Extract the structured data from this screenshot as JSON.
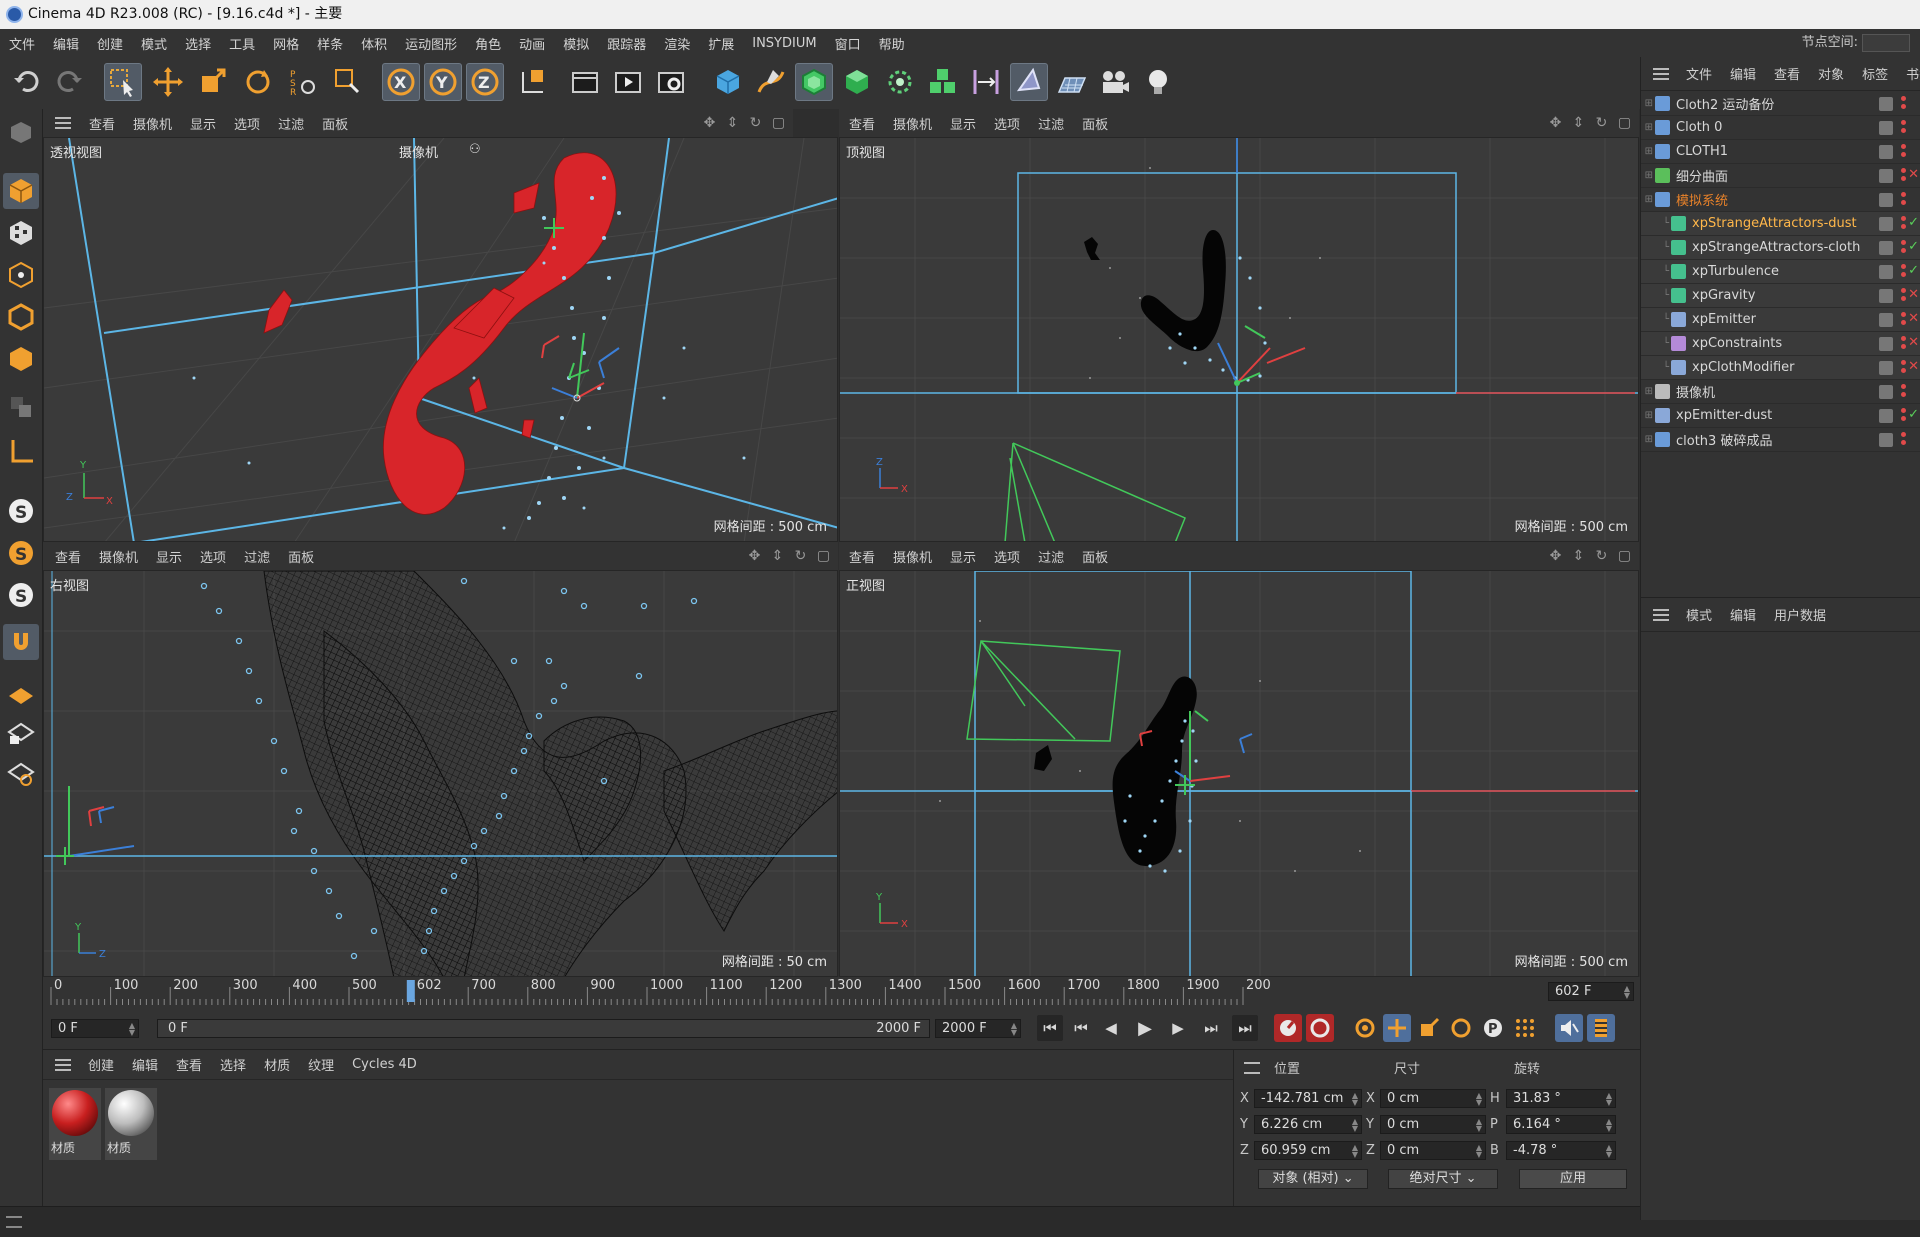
{
  "window": {
    "title": "Cinema 4D R23.008 (RC) - [9.16.c4d *] - 主要"
  },
  "menubar": {
    "items": [
      "文件",
      "编辑",
      "创建",
      "模式",
      "选择",
      "工具",
      "网格",
      "样条",
      "体积",
      "运动图形",
      "角色",
      "动画",
      "模拟",
      "跟踪器",
      "渲染",
      "扩展",
      "INSYDIUM",
      "窗口",
      "帮助"
    ],
    "node_space_label": "节点空间:"
  },
  "viewports": {
    "menu": [
      "查看",
      "摄像机",
      "显示",
      "选项",
      "过滤",
      "面板"
    ],
    "perspective": {
      "label": "透视视图",
      "camera": "摄像机",
      "grid": "网格间距 : 500 cm"
    },
    "top": {
      "label": "顶视图",
      "grid": "网格间距 : 500 cm"
    },
    "right": {
      "label": "右视图",
      "grid": "网格间距 : 50 cm"
    },
    "front": {
      "label": "正视图",
      "grid": "网格间距 : 500 cm"
    }
  },
  "object_manager": {
    "menu": [
      "文件",
      "编辑",
      "查看",
      "对象",
      "标签",
      "书签"
    ],
    "objects": [
      {
        "name": "Cloth2 运动备份",
        "indent": 0,
        "color": "#6a9bd8",
        "state": "dot"
      },
      {
        "name": "Cloth 0",
        "indent": 0,
        "color": "#6a9bd8",
        "state": "dot"
      },
      {
        "name": "CLOTH1",
        "indent": 0,
        "color": "#6a9bd8",
        "state": "dot"
      },
      {
        "name": "细分曲面",
        "indent": 0,
        "color": "#5bbf5b",
        "state": "cross"
      },
      {
        "name": "模拟系统",
        "indent": 0,
        "color": "#6a9bd8",
        "state": "dot",
        "highlight": "#e8822a"
      },
      {
        "name": "xpStrangeAttractors-dust",
        "indent": 1,
        "color": "#45c08e",
        "state": "check",
        "highlight": "#ffb74a"
      },
      {
        "name": "xpStrangeAttractors-cloth",
        "indent": 1,
        "color": "#45c08e",
        "state": "check"
      },
      {
        "name": "xpTurbulence",
        "indent": 1,
        "color": "#45c08e",
        "state": "check"
      },
      {
        "name": "xpGravity",
        "indent": 1,
        "color": "#45c08e",
        "state": "cross"
      },
      {
        "name": "xpEmitter",
        "indent": 1,
        "color": "#8aa8d8",
        "state": "cross"
      },
      {
        "name": "xpConstraints",
        "indent": 1,
        "color": "#b48ad8",
        "state": "cross"
      },
      {
        "name": "xpClothModifier",
        "indent": 1,
        "color": "#8aa8d8",
        "state": "cross"
      },
      {
        "name": "摄像机",
        "indent": 0,
        "color": "#bbbbbb",
        "state": "tag"
      },
      {
        "name": "xpEmitter-dust",
        "indent": 0,
        "color": "#8aa8d8",
        "state": "check"
      },
      {
        "name": "cloth3 破碎成品",
        "indent": 0,
        "color": "#6a9bd8",
        "state": "dot"
      }
    ]
  },
  "attribute_manager": {
    "menu": [
      "模式",
      "编辑",
      "用户数据"
    ]
  },
  "timeline": {
    "ticks": [
      "0",
      "100",
      "200",
      "300",
      "400",
      "500",
      "602",
      "700",
      "800",
      "900",
      "1000",
      "1100",
      "1200",
      "1300",
      "1400",
      "1500",
      "1600",
      "1700",
      "1800",
      "1900",
      "200"
    ],
    "current_frame": 602,
    "current_frame_label": "602",
    "current_frame_field": "602 F",
    "start_field": "0 F",
    "range_start": "0 F",
    "range_end": "2000 F",
    "end_field": "2000 F"
  },
  "material_manager": {
    "menu": [
      "创建",
      "编辑",
      "查看",
      "选择",
      "材质",
      "纹理",
      "Cycles 4D"
    ],
    "materials": [
      {
        "name": "材质",
        "color": "#c81f1f"
      },
      {
        "name": "材质",
        "color": "#bdbdbd"
      }
    ]
  },
  "coordinates": {
    "headers": [
      "位置",
      "尺寸",
      "旋转"
    ],
    "rows": [
      {
        "axis": "X",
        "pos": "-142.781 cm",
        "size_axis": "X",
        "size": "0 cm",
        "rot_axis": "H",
        "rot": "31.83 °"
      },
      {
        "axis": "Y",
        "pos": "6.226 cm",
        "size_axis": "Y",
        "size": "0 cm",
        "rot_axis": "P",
        "rot": "6.164 °"
      },
      {
        "axis": "Z",
        "pos": "60.959 cm",
        "size_axis": "Z",
        "size": "0 cm",
        "rot_axis": "B",
        "rot": "-4.78 °"
      }
    ],
    "mode_dropdown": "对象 (相对)",
    "size_dropdown": "绝对尺寸",
    "apply_button": "应用"
  },
  "colors": {
    "accent": "#6aa6e0",
    "selection": "#525b66",
    "red_mesh": "#d8252a",
    "grid_blue": "#5cb6e6",
    "axis_red": "#e04040",
    "axis_green": "#42c85a"
  }
}
